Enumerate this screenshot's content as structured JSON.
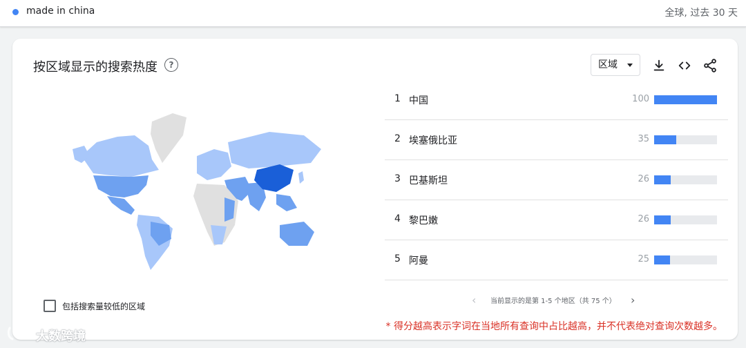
{
  "header": {
    "term": "made in china",
    "term_color": "#4285f4",
    "scope": "全球, 过去 30 天"
  },
  "card": {
    "title": "按区域显示的搜索热度",
    "help_icon": "help-circle-icon",
    "region_select": "区域",
    "actions": [
      "download-icon",
      "embed-code-icon",
      "share-icon"
    ]
  },
  "ranking": [
    {
      "rank": "1",
      "name": "中国",
      "value": 100
    },
    {
      "rank": "2",
      "name": "埃塞俄比亚",
      "value": 35
    },
    {
      "rank": "3",
      "name": "巴基斯坦",
      "value": 26
    },
    {
      "rank": "4",
      "name": "黎巴嫩",
      "value": 26
    },
    {
      "rank": "5",
      "name": "阿曼",
      "value": 25
    }
  ],
  "pagination": {
    "text": "当前显示的是第 1-5 个地区（共 75 个）"
  },
  "include_low_volume": {
    "label": "包括搜索量较低的区域",
    "checked": false
  },
  "footnote": "* 得分越高表示字词在当地所有查询中占比越高，并不代表绝对查询次数越多。",
  "watermark": {
    "text": "大数跨境"
  },
  "colors": {
    "accent": "#4285f4",
    "map_high": "#1a5fd8",
    "map_mid": "#6ea1f0",
    "map_low": "#a8c7fa",
    "map_none": "#e0e0e0",
    "footnote": "#d93025"
  }
}
